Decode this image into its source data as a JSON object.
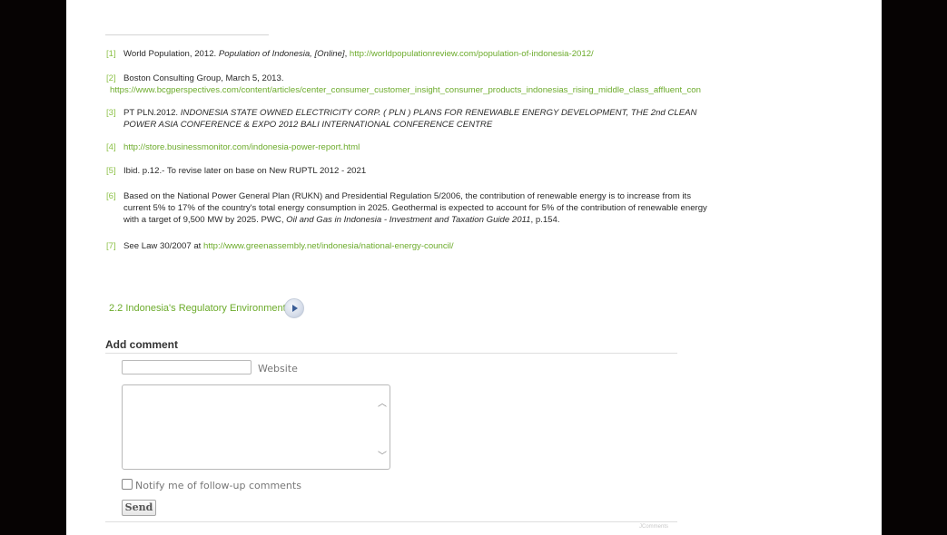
{
  "footnotes": [
    {
      "num": "[1]",
      "parts": [
        {
          "text": "World Population, 2012. ",
          "style": "plain"
        },
        {
          "text": "Population of Indonesia, [Online]",
          "style": "italic"
        },
        {
          "text": ", ",
          "style": "plain"
        },
        {
          "text": "http://worldpopulationreview.com/population-of-indonesia-2012/",
          "style": "link"
        }
      ]
    },
    {
      "num": "[2]",
      "lines": [
        [
          {
            "text": "Boston Consulting Group, March 5, 2013.",
            "style": "plain"
          }
        ],
        [
          {
            "text": "https://www.bcgperspectives.com/content/articles/center_consumer_customer_insight_consumer_products_indonesias_rising_middle_class_affluent_con",
            "style": "link"
          }
        ]
      ]
    },
    {
      "num": "[3]",
      "lines": [
        [
          {
            "text": "PT PLN.2012. ",
            "style": "plain"
          },
          {
            "text": "INDONESIA STATE OWNED ELECTRICITY CORP. ( PLN ) PLANS FOR RENEWABLE ENERGY DEVELOPMENT, THE 2nd CLEAN",
            "style": "italic"
          }
        ],
        [
          {
            "text": "POWER ASIA CONFERENCE & EXPO 2012 BALI INTERNATIONAL CONFERENCE CENTRE",
            "style": "italic"
          }
        ]
      ]
    },
    {
      "num": "[4]",
      "parts": [
        {
          "text": "http://store.businessmonitor.com/indonesia-power-report.html",
          "style": "link"
        }
      ]
    },
    {
      "num": "[5]",
      "parts": [
        {
          "text": "Ibid. p.12.- To revise later on base on New RUPTL 2012 - 2021",
          "style": "plain"
        }
      ]
    },
    {
      "num": "[6]",
      "lines": [
        [
          {
            "text": "Based on the National Power General Plan (RUKN) and Presidential Regulation 5/2006, the contribution of renewable energy is to increase from its",
            "style": "plain"
          }
        ],
        [
          {
            "text": "current 5% to 17% of the country's total energy consumption in 2025. Geothermal is expected to account for 5% of the contribution of renewable energy",
            "style": "plain"
          }
        ],
        [
          {
            "text": "with a target of 9,500 MW by 2025. PWC, ",
            "style": "plain"
          },
          {
            "text": "Oil and Gas in Indonesia - Investment and Taxation Guide 2011",
            "style": "italic"
          },
          {
            "text": ", p.154.",
            "style": "plain"
          }
        ]
      ]
    },
    {
      "num": "[7]",
      "parts": [
        {
          "text": "See Law 30/2007 at ",
          "style": "plain"
        },
        {
          "text": "http://www.greenassembly.net/indonesia/national-energy-council/",
          "style": "link"
        }
      ]
    }
  ],
  "section_link": "2.2 Indonesia's Regulatory Environment",
  "play_icon": "play-circle-icon",
  "comment_form": {
    "heading": "Add comment",
    "website_label": "Website",
    "website_value": "",
    "comment_value": "",
    "notify_label": "Notify me of follow-up comments",
    "send_label": "Send",
    "footer_credit": "JComments"
  },
  "colors": {
    "link": "#6cab2b",
    "frame": "#060303"
  }
}
